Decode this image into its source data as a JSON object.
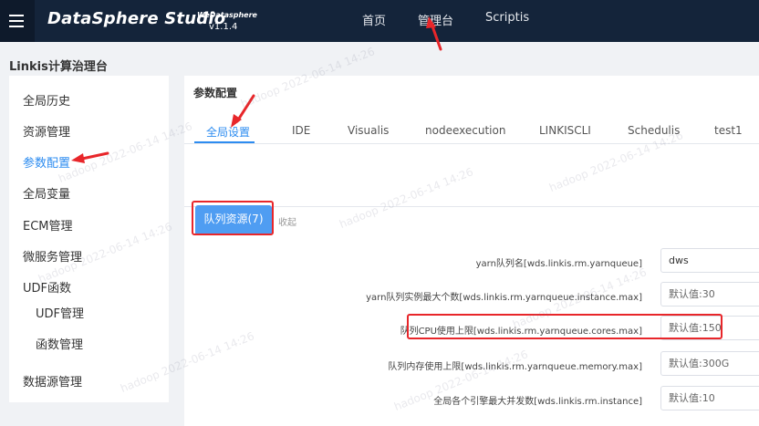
{
  "header": {
    "brand": "DataSphere Studio",
    "brand_sub": "WeDatasphere",
    "version": "v1.1.4",
    "nav": [
      {
        "label": "首页"
      },
      {
        "label": "管理台"
      },
      {
        "label": "Scriptis"
      }
    ]
  },
  "app_title": "Linkis计算治理台",
  "sidebar": {
    "items": [
      {
        "label": "全局历史"
      },
      {
        "label": "资源管理"
      },
      {
        "label": "参数配置"
      },
      {
        "label": "全局变量"
      },
      {
        "label": "ECM管理"
      },
      {
        "label": "微服务管理"
      },
      {
        "label": "UDF函数"
      },
      {
        "label": "UDF管理"
      },
      {
        "label": "函数管理"
      },
      {
        "label": "数据源管理"
      }
    ]
  },
  "main": {
    "title": "参数配置",
    "tabs": [
      {
        "label": "全局设置"
      },
      {
        "label": "IDE"
      },
      {
        "label": "Visualis"
      },
      {
        "label": "nodeexecution"
      },
      {
        "label": "LINKISCLI"
      },
      {
        "label": "Schedulis"
      },
      {
        "label": "test1"
      }
    ],
    "queue_button": "队列资源(7)",
    "collapse": "收起",
    "fields": [
      {
        "label": "yarn队列名[wds.linkis.rm.yarnqueue]",
        "value": "dws",
        "placeholder": ""
      },
      {
        "label": "yarn队列实例最大个数[wds.linkis.rm.yarnqueue.instance.max]",
        "value": "",
        "placeholder": "默认值:30"
      },
      {
        "label": "队列CPU使用上限[wds.linkis.rm.yarnqueue.cores.max]",
        "value": "",
        "placeholder": "默认值:150"
      },
      {
        "label": "队列内存使用上限[wds.linkis.rm.yarnqueue.memory.max]",
        "value": "",
        "placeholder": "默认值:300G"
      },
      {
        "label": "全局各个引擎最大并发数[wds.linkis.rm.instance]",
        "value": "",
        "placeholder": "默认值:10"
      }
    ]
  },
  "watermark": "hadoop 2022-06-14 14:26",
  "colors": {
    "header_bg": "#14243a",
    "accent": "#2d8cf0",
    "annotation_red": "#e8262a"
  }
}
